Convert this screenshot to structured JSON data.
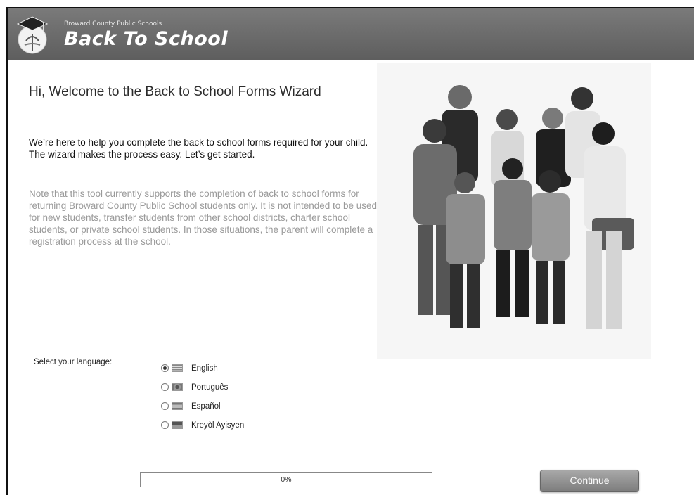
{
  "header": {
    "org_name": "Broward County Public Schools",
    "app_title": "Back To School"
  },
  "main": {
    "welcome_title": "Hi, Welcome to the Back to School Forms Wizard",
    "intro": "We’re here to help you complete the back to school forms required for your child. The wizard makes the process easy. Let’s get started.",
    "note": "Note that this tool currently supports the completion of back to school forms for returning Broward County Public School students only. It is not intended to be used for new students, transfer students from other school districts, charter school students, or private school students. In those situations, the parent will complete a registration process at the school."
  },
  "language": {
    "label": "Select your language:",
    "selected": "English",
    "options": [
      {
        "label": "English",
        "flag_icon": "us-flag-icon"
      },
      {
        "label": "Português",
        "flag_icon": "brazil-flag-icon"
      },
      {
        "label": "Español",
        "flag_icon": "spain-flag-icon"
      },
      {
        "label": "Kreyòl Ayisyen",
        "flag_icon": "haiti-flag-icon"
      }
    ]
  },
  "footer": {
    "progress_text": "0%",
    "progress_value": 0,
    "continue_label": "Continue"
  }
}
